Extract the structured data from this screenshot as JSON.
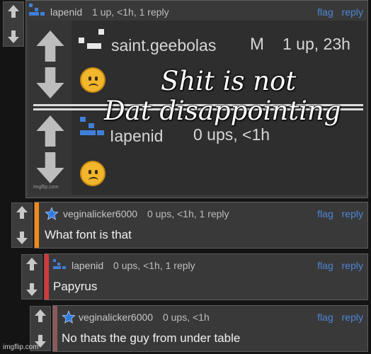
{
  "top_comment": {
    "username": "lapenid",
    "meta": "1 up, <1h, 1 reply",
    "flag": "flag",
    "reply": "reply"
  },
  "meme": {
    "user1": "saint.geebolas",
    "user1_badge": "M",
    "user1_meta": "1 up, 23h",
    "user2": "Iapenid",
    "user2_meta": "0 ups, <1h",
    "caption_line1": "Shit is not",
    "caption_line2": "Dat disappointing",
    "watermark": "imgflip.com"
  },
  "comments": [
    {
      "username": "veginalicker6000",
      "meta": "0 ups, <1h, 1 reply",
      "body": "What font is that",
      "flag": "flag",
      "reply": "reply",
      "accent": "#f08a18"
    },
    {
      "username": "lapenid",
      "meta": "0 ups, <1h, 1 reply",
      "body": "Papyrus",
      "flag": "flag",
      "reply": "reply",
      "accent": "#d23a3a"
    },
    {
      "username": "veginalicker6000",
      "meta": "0 ups, <1h",
      "body": "No thats the guy from under table",
      "flag": "flag",
      "reply": "reply",
      "accent": "#8b5a5a"
    }
  ],
  "footer": {
    "watermark": "imgflip.com"
  },
  "colors": {
    "link": "#4e86d8",
    "avatar_blue": "#3f7fd8",
    "star": "#2e7be0"
  },
  "icons": [
    "upvote-arrow-icon",
    "downvote-arrow-icon",
    "pixel-avatar-icon",
    "star-badge-icon",
    "frown-emoji-icon"
  ]
}
